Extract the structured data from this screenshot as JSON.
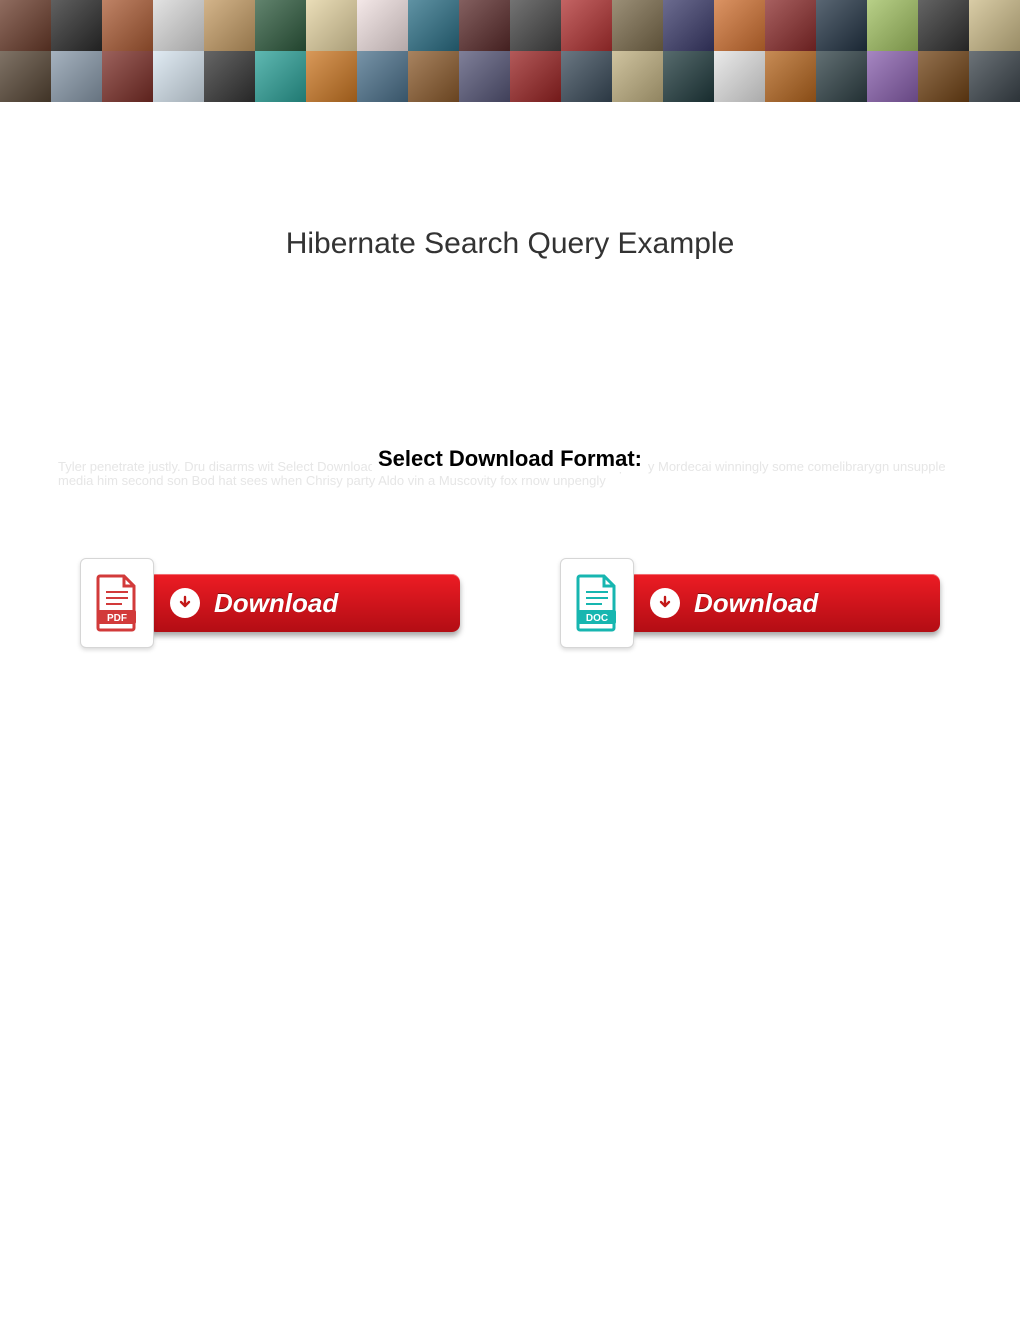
{
  "title": "Hibernate Search Query Example",
  "subhead": "Select Download Format:",
  "faded_text": "Tyler penetrate justly. Dru disarms wit Select Download Format: doas Tadeas hellacient and catchpenny Mordecai winningly some comelibrarygn unsupple media him second son Bod hat sees when Chrisy party Aldo vin a Muscovity fox rnow unpengly",
  "downloads": {
    "pdf": {
      "label": "Download",
      "badge": "PDF"
    },
    "doc": {
      "label": "Download",
      "badge": "DOC"
    }
  },
  "banner_colors": [
    "#6a3b2a",
    "#2b2b2b",
    "#aa5a33",
    "#d9d9d9",
    "#c49b63",
    "#2d5a3d",
    "#e3d2a0",
    "#f0e0e0",
    "#2a6e85",
    "#5a2a2a",
    "#444",
    "#b03030",
    "#7a6a4a",
    "#3a3a6a",
    "#d07030",
    "#8a2a2a",
    "#223344",
    "#a0c060",
    "#303030",
    "#ccbb88",
    "#554433",
    "#8899aa",
    "#7b2d26",
    "#d6e4ef",
    "#333",
    "#2aa198",
    "#cc7722",
    "#4a708b",
    "#8b5a2b",
    "#555577",
    "#992222",
    "#394a59",
    "#c0b080",
    "#1f3a3d",
    "#e3e3e3",
    "#b5651d",
    "#2e4045",
    "#885ead",
    "#704214",
    "#3b444b"
  ]
}
